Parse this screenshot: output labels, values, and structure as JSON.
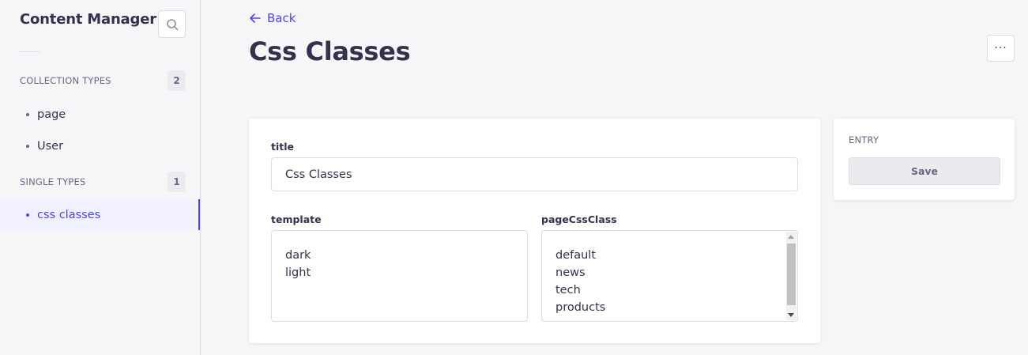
{
  "sidebar": {
    "title": "Content Manager",
    "collection_types": {
      "label": "COLLECTION TYPES",
      "count": "2",
      "items": [
        {
          "label": "page"
        },
        {
          "label": "User"
        }
      ]
    },
    "single_types": {
      "label": "SINGLE TYPES",
      "count": "1",
      "items": [
        {
          "label": "css classes",
          "active": true
        }
      ]
    }
  },
  "header": {
    "back_label": "Back",
    "title": "Css Classes",
    "more_label": "···"
  },
  "form": {
    "title": {
      "label": "title",
      "value": "Css Classes"
    },
    "template": {
      "label": "template",
      "options": [
        "dark",
        "light"
      ]
    },
    "pageCssClass": {
      "label": "pageCssClass",
      "options": [
        "default",
        "news",
        "tech",
        "products"
      ]
    }
  },
  "entry_panel": {
    "heading": "ENTRY",
    "save_label": "Save"
  },
  "colors": {
    "accent": "#4945ff",
    "text": "#32324d",
    "muted": "#666687",
    "background": "#f6f6f9",
    "border": "#dcdce4"
  }
}
